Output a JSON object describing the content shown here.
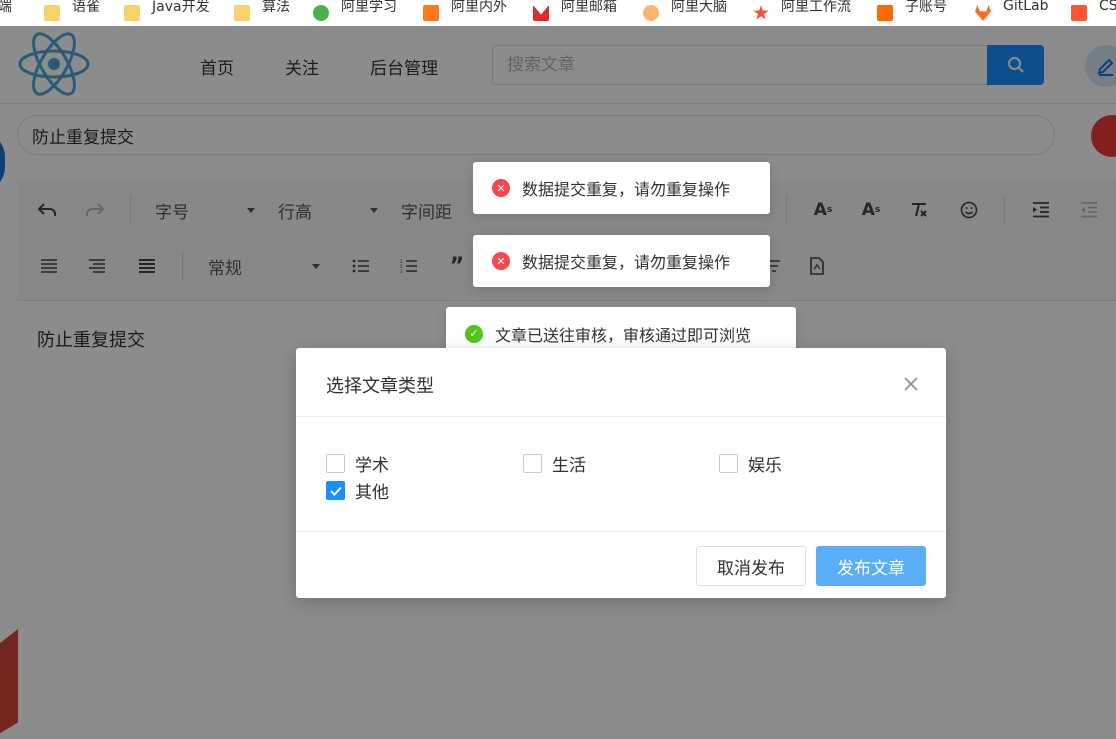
{
  "bookmarks": [
    {
      "label": "前端",
      "icon": "folder-icon"
    },
    {
      "label": "语雀",
      "icon": "folder-icon"
    },
    {
      "label": "Java开发",
      "icon": "folder-icon"
    },
    {
      "label": "算法",
      "icon": "folder-icon"
    },
    {
      "label": "阿里学习",
      "icon": "learn-icon"
    },
    {
      "label": "阿里内外",
      "icon": "neiwai-icon"
    },
    {
      "label": "阿里邮箱",
      "icon": "mail-icon"
    },
    {
      "label": "阿里大脑",
      "icon": "brain-icon"
    },
    {
      "label": "阿里工作流",
      "icon": "workflow-icon"
    },
    {
      "label": "子账号",
      "icon": "subaccount-icon"
    },
    {
      "label": "GitLab",
      "icon": "gitlab-icon"
    },
    {
      "label": "CS",
      "icon": "csdn-icon"
    }
  ],
  "header": {
    "nav": [
      "首页",
      "关注",
      "后台管理"
    ],
    "search_placeholder": "搜索文章"
  },
  "article": {
    "title": "防止重复提交",
    "content": "防止重复提交"
  },
  "toolbar": {
    "font_size": "字号",
    "line_height": "行高",
    "letter_spacing": "字间距",
    "paragraph": "常规"
  },
  "messages": [
    {
      "type": "error",
      "text": "数据提交重复，请勿重复操作"
    },
    {
      "type": "error",
      "text": "数据提交重复，请勿重复操作"
    },
    {
      "type": "success",
      "text": "文章已送往审核，审核通过即可浏览"
    }
  ],
  "dialog": {
    "title": "选择文章类型",
    "options": [
      {
        "label": "学术",
        "checked": false
      },
      {
        "label": "生活",
        "checked": false
      },
      {
        "label": "娱乐",
        "checked": false
      },
      {
        "label": "其他",
        "checked": true
      }
    ],
    "cancel_label": "取消发布",
    "confirm_label": "发布文章"
  },
  "colors": {
    "primary": "#1890ff",
    "error": "#f5474b",
    "success": "#52c41a"
  }
}
